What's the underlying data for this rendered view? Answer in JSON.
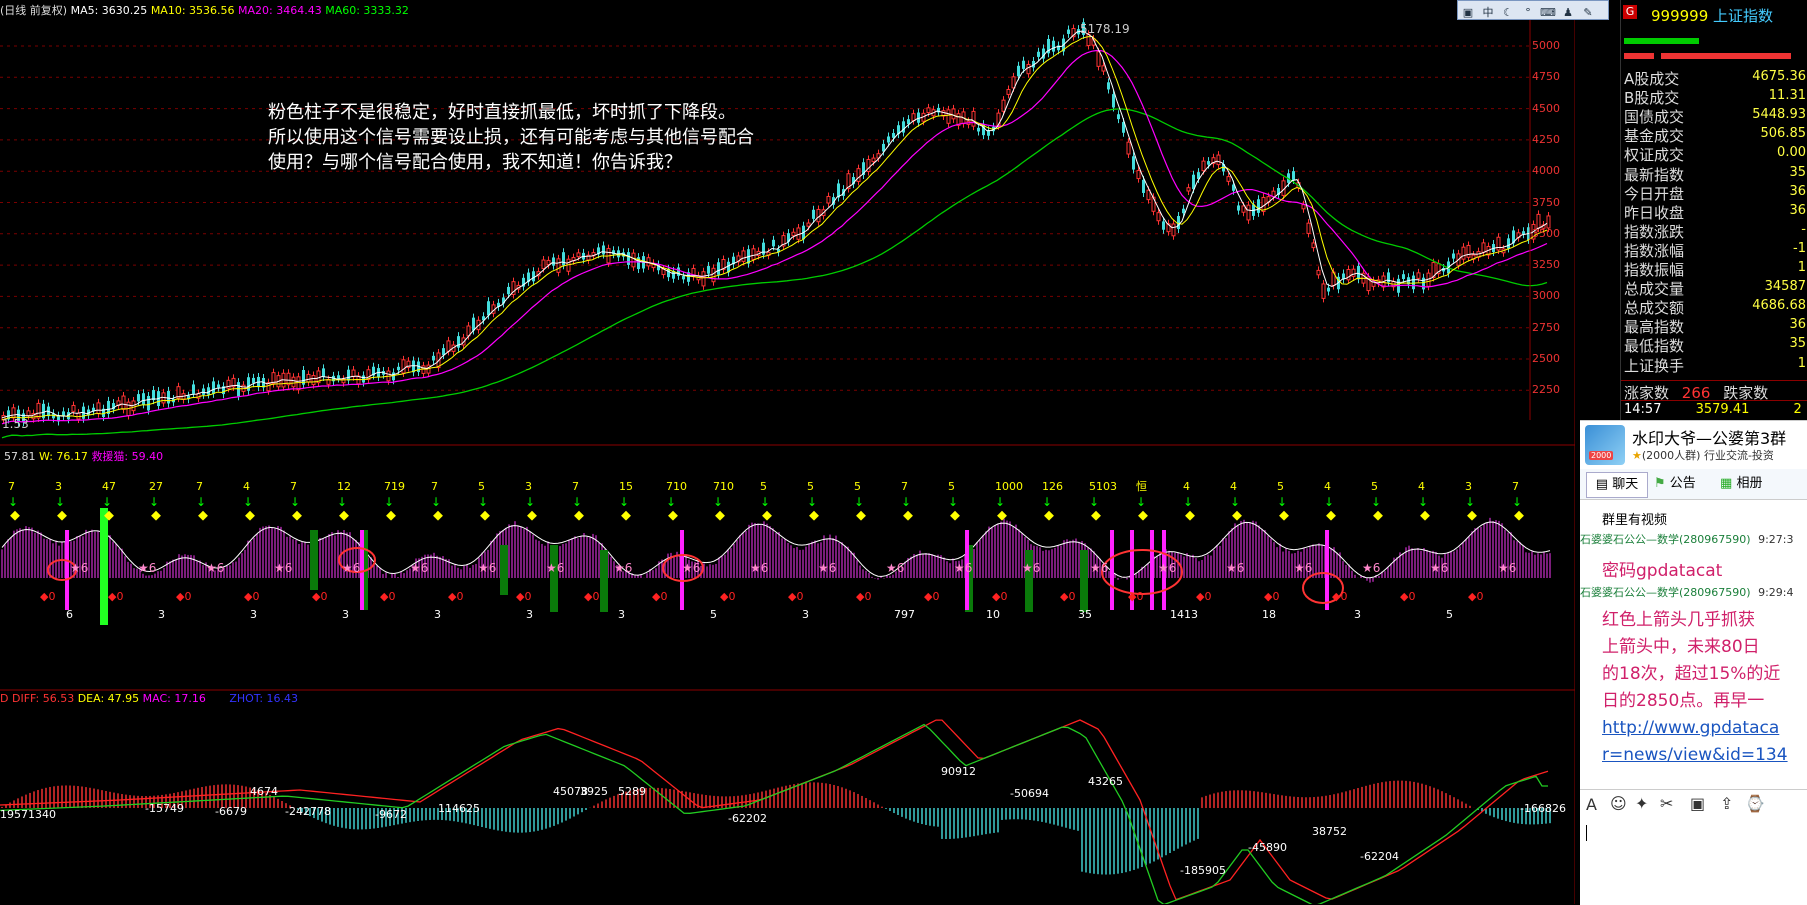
{
  "main_header": {
    "title": "(日线 前复权)",
    "ma5": "MA5: 3630.25",
    "ma10": "MA10: 3536.56",
    "ma20": "MA20: 3464.43",
    "ma60": "MA60: 3333.32"
  },
  "peak_label": "5178.19",
  "left_low_label": "1.53",
  "price_axis": [
    "5000",
    "4750",
    "4500",
    "4250",
    "4000",
    "3750",
    "3500",
    "3250",
    "3000",
    "2750",
    "2500",
    "2250"
  ],
  "annotation": {
    "line1": "粉色柱子不是很稳定，好时直接抓最低，坏时抓了下降段。",
    "line2": "所以使用这个信号需要设止损，还有可能考虑与其他信号配合",
    "line3": "使用？与哪个信号配合使用，我不知道！你告诉我？"
  },
  "indicator_header": {
    "v1": "57.81",
    "w": "W: 76.17",
    "note": "救援猫: 59.40"
  },
  "signal_top_numbers": [
    "7",
    "3",
    "47",
    "27",
    "7",
    "4",
    "7",
    "12",
    "719",
    "7",
    "5",
    "3",
    "7",
    "15",
    "710",
    "710",
    "5",
    "5",
    "5",
    "7",
    "5",
    "1000",
    "126",
    "5103",
    "恒",
    "4",
    "4",
    "5",
    "4",
    "5",
    "4",
    "3",
    "7"
  ],
  "signal_bottom_numbers": [
    "6",
    "3",
    "3",
    "3",
    "3",
    "3",
    "3",
    "5",
    "3",
    "797",
    "10",
    "35",
    "1413",
    "18",
    "3",
    "5"
  ],
  "macd_header": {
    "d": "D",
    "diff": "DIFF: 56.53",
    "dea": "DEA: 47.95",
    "mac": "MAC: 17.16",
    "zhot": "ZHOT: 16.43"
  },
  "macd_labels": [
    "19571340",
    "-15749",
    "-6679",
    "4674",
    "-242778",
    "-9672",
    "114625",
    "45078",
    "3925",
    "5289",
    "-62202",
    "90912",
    "-50694",
    "43265",
    "-185905",
    "-45890",
    "38752",
    "-62204",
    "-166826"
  ],
  "right_panel": {
    "code": "999999",
    "name": "上证指数",
    "rows": [
      {
        "label": "A股成交",
        "value": "4675.36"
      },
      {
        "label": "B股成交",
        "value": "11.31"
      },
      {
        "label": "国债成交",
        "value": "5448.93"
      },
      {
        "label": "基金成交",
        "value": "506.85"
      },
      {
        "label": "权证成交",
        "value": "0.00"
      },
      {
        "label": "最新指数",
        "value": "35"
      },
      {
        "label": "今日开盘",
        "value": "36"
      },
      {
        "label": "昨日收盘",
        "value": "36"
      },
      {
        "label": "指数涨跌",
        "value": "-"
      },
      {
        "label": "指数涨幅",
        "value": "-1"
      },
      {
        "label": "指数振幅",
        "value": "1"
      },
      {
        "label": "总成交量",
        "value": "34587"
      },
      {
        "label": "总成交额",
        "value": "4686.68"
      },
      {
        "label": "最高指数",
        "value": "36"
      },
      {
        "label": "最低指数",
        "value": "35"
      },
      {
        "label": "上证换手",
        "value": "1"
      }
    ],
    "up_count_label": "涨家数",
    "up_count": "266",
    "down_count_label": "跌家数",
    "time": "14:57",
    "price": "3579.41",
    "tail": "2"
  },
  "chat": {
    "group_name": "水印大爷—公婆第3群",
    "group_meta": "(2000人群) 行业交流-投资",
    "tab_chat": "聊天",
    "tab_notice": "公告",
    "tab_album": "相册",
    "video_notice": "群里有视频",
    "msg1_sender": "石婆婆石公公—数学(280967590)",
    "msg1_time": "9:27:3",
    "msg1_text": "密码gpdatacat",
    "msg2_sender": "石婆婆石公公—数学(280967590)",
    "msg2_time": "9:29:4",
    "msg2_line1": "红色上箭头几乎抓获",
    "msg2_line2": "上箭头中，未来80日",
    "msg2_line3": "的18次，超过15%的近",
    "msg2_line4": "日的2850点。再早一",
    "msg2_link1": "http://www.gpdataca",
    "msg2_link2": "r=news/view&id=134",
    "badge": "2000"
  },
  "colors": {
    "ma5": "#ffffff",
    "ma10": "#ffff00",
    "ma20": "#ff00ff",
    "ma60": "#00ff00",
    "up": "#ff3333",
    "down": "#44dddd",
    "grid": "#8b0000"
  }
}
